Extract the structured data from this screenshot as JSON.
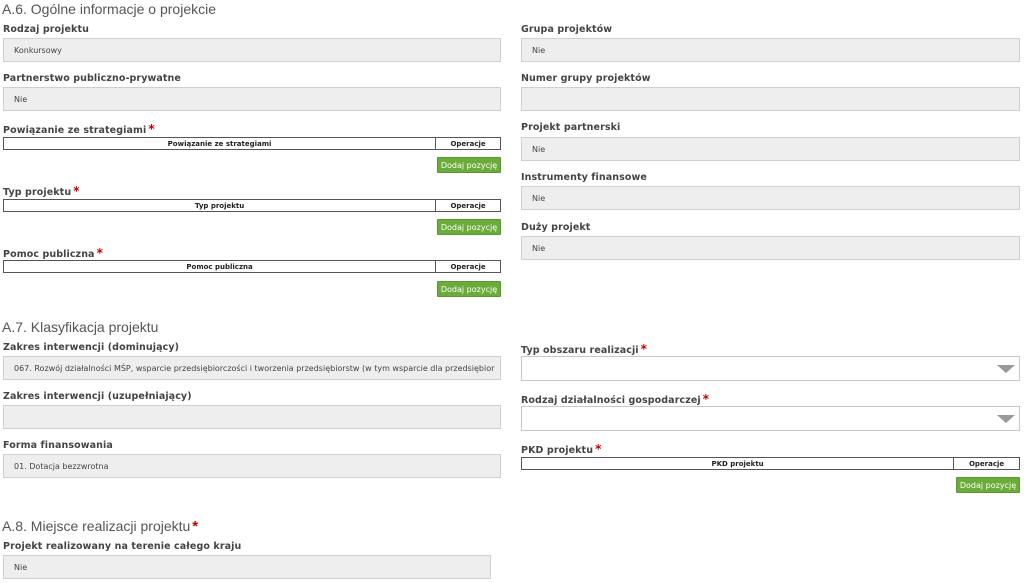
{
  "a6": {
    "title": "A.6. Ogólne informacje o projekcie",
    "rodzaj_projektu": {
      "label": "Rodzaj projektu",
      "value": "Konkursowy"
    },
    "partnerstwo": {
      "label": "Partnerstwo publiczno-prywatne",
      "value": "Nie"
    },
    "powiazanie": {
      "label": "Powiązanie ze strategiami",
      "required": "*",
      "col": "Powiązanie ze strategiami",
      "op": "Operacje",
      "button": "Dodaj pozycję"
    },
    "typ_projektu": {
      "label": "Typ projektu",
      "required": "*",
      "col": "Typ projektu",
      "op": "Operacje",
      "button": "Dodaj pozycję"
    },
    "pomoc_publiczna": {
      "label": "Pomoc publiczna",
      "required": "*",
      "col": "Pomoc publiczna",
      "op": "Operacje",
      "button": "Dodaj pozycję"
    },
    "grupa_projektow": {
      "label": "Grupa projektów",
      "value": "Nie"
    },
    "numer_grupy": {
      "label": "Numer grupy projektów",
      "value": ""
    },
    "projekt_partnerski": {
      "label": "Projekt partnerski",
      "value": "Nie"
    },
    "instrumenty": {
      "label": "Instrumenty finansowe",
      "value": "Nie"
    },
    "duzy_projekt": {
      "label": "Duży projekt",
      "value": "Nie"
    }
  },
  "a7": {
    "title": "A.7. Klasyfikacja projektu",
    "zakres_dom": {
      "label": "Zakres interwencji (dominujący)",
      "value": "067. Rozwój działalności MŚP, wsparcie przedsiębiorczości i tworzenia przedsiębiorstw (w tym wsparcie dla przedsiębior"
    },
    "zakres_uzup": {
      "label": "Zakres interwencji (uzupełniający)",
      "value": ""
    },
    "forma": {
      "label": "Forma finansowania",
      "value": "01. Dotacja bezzwrotna"
    },
    "typ_obszaru": {
      "label": "Typ obszaru realizacji",
      "required": "*",
      "value": ""
    },
    "rodzaj_dzialalnosci": {
      "label": "Rodzaj działalności gospodarczej",
      "required": "*",
      "value": ""
    },
    "pkd": {
      "label": "PKD projektu",
      "required": "*",
      "col": "PKD projektu",
      "op": "Operacje",
      "button": "Dodaj pozycję"
    }
  },
  "a8": {
    "title": "A.8. Miejsce realizacji projektu",
    "required": "*",
    "caly_kraj": {
      "label": "Projekt realizowany na terenie całego kraju",
      "value": "Nie"
    }
  }
}
